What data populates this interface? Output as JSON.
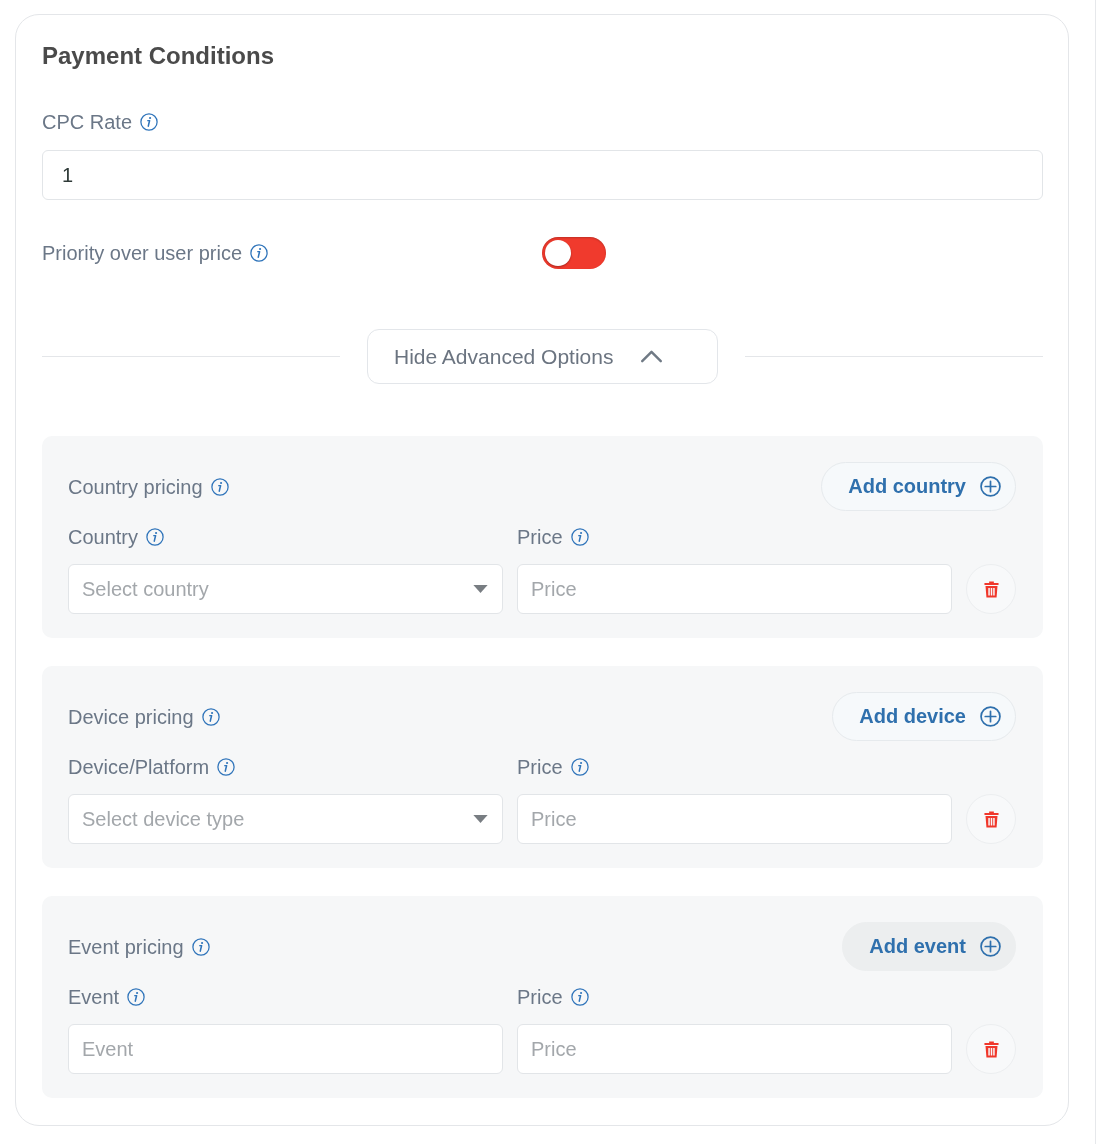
{
  "card": {
    "title": "Payment Conditions"
  },
  "cpc_rate": {
    "label": "CPC Rate",
    "value": "1"
  },
  "priority_over_user_price": {
    "label": "Priority over user price",
    "on": false
  },
  "advanced_options": {
    "label": "Hide Advanced Options",
    "expanded": true
  },
  "pricing_sections": [
    {
      "title": "Country pricing",
      "add_button": {
        "label": "Add country",
        "hovered": false
      },
      "fields": [
        {
          "kind": "select",
          "label": "Country",
          "placeholder": "Select country"
        },
        {
          "kind": "input",
          "label": "Price",
          "placeholder": "Price"
        }
      ]
    },
    {
      "title": "Device pricing",
      "add_button": {
        "label": "Add device",
        "hovered": false
      },
      "fields": [
        {
          "kind": "select",
          "label": "Device/Platform",
          "placeholder": "Select device type"
        },
        {
          "kind": "input",
          "label": "Price",
          "placeholder": "Price"
        }
      ]
    },
    {
      "title": "Event pricing",
      "add_button": {
        "label": "Add event",
        "hovered": true
      },
      "fields": [
        {
          "kind": "input",
          "label": "Event",
          "placeholder": "Event"
        },
        {
          "kind": "input",
          "label": "Price",
          "placeholder": "Price"
        }
      ]
    }
  ]
}
